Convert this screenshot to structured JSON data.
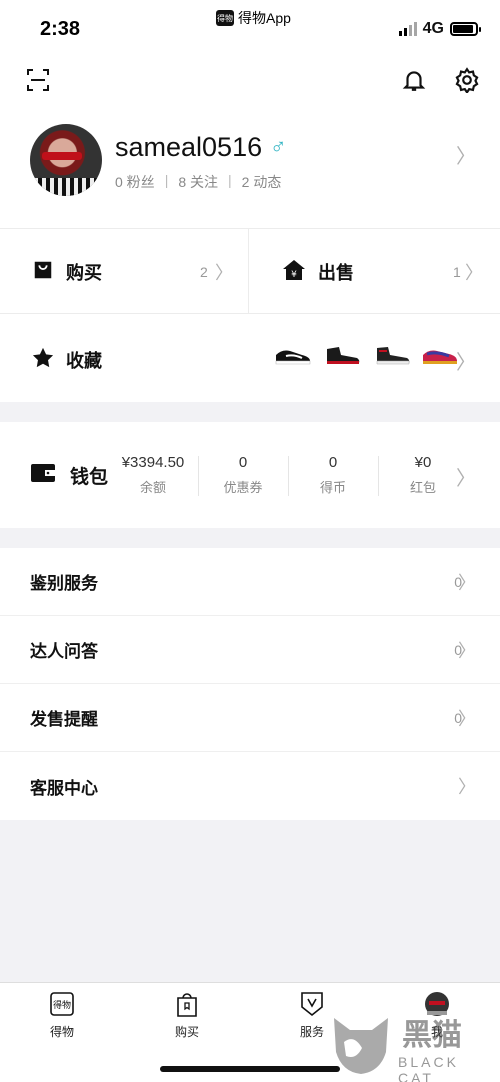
{
  "status": {
    "time": "2:38",
    "app": "得物App",
    "network": "4G",
    "app_badge": "得物"
  },
  "profile": {
    "username": "sameal0516",
    "gender_symbol": "♂",
    "fans": "0 粉丝",
    "following": "8 关注",
    "posts": "2 动态"
  },
  "orders": {
    "buy_label": "购买",
    "buy_count": "2",
    "sell_label": "出售",
    "sell_count": "1"
  },
  "collection": {
    "label": "收藏"
  },
  "wallet": {
    "label": "钱包",
    "items": [
      {
        "value": "¥3394.50",
        "label": "余额"
      },
      {
        "value": "0",
        "label": "优惠券"
      },
      {
        "value": "0",
        "label": "得币"
      },
      {
        "value": "¥0",
        "label": "红包"
      }
    ]
  },
  "menu": [
    {
      "label": "鉴别服务",
      "count": "0"
    },
    {
      "label": "达人问答",
      "count": "0"
    },
    {
      "label": "发售提醒",
      "count": "0"
    },
    {
      "label": "客服中心",
      "count": ""
    }
  ],
  "tabs": [
    {
      "label": "得物",
      "icon": "dewu-logo-icon"
    },
    {
      "label": "购买",
      "icon": "shopping-bag-icon"
    },
    {
      "label": "服务",
      "icon": "shield-v-icon"
    },
    {
      "label": "我",
      "icon": "avatar-icon"
    }
  ],
  "watermark": {
    "title": "黑猫",
    "subtitle": "BLACK CAT"
  },
  "colors": {
    "accent": "#33b5c4",
    "background": "#f2f2f5"
  }
}
